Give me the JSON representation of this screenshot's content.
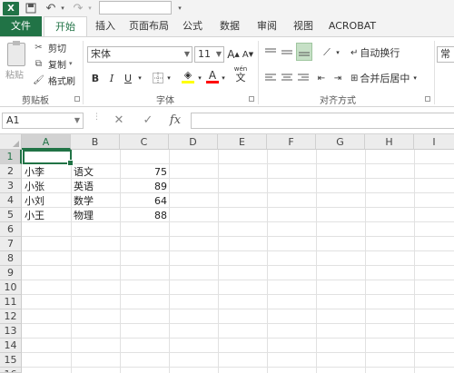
{
  "quick_access": {
    "logo": "X",
    "save_icon": "save-icon",
    "undo_icon": "undo-icon",
    "redo_icon": "redo-icon",
    "customize_icon": "customize-qat-icon",
    "search_value": ""
  },
  "tabs": [
    {
      "label": "文件"
    },
    {
      "label": "开始"
    },
    {
      "label": "插入"
    },
    {
      "label": "页面布局"
    },
    {
      "label": "公式"
    },
    {
      "label": "数据"
    },
    {
      "label": "审阅"
    },
    {
      "label": "视图"
    },
    {
      "label": "ACROBAT"
    }
  ],
  "ribbon": {
    "clipboard": {
      "paste": "粘贴",
      "cut": "剪切",
      "copy": "复制",
      "format_painter": "格式刷",
      "group_label": "剪贴板"
    },
    "font": {
      "font_name": "宋体",
      "font_size": "11",
      "bold": "B",
      "italic": "I",
      "underline": "U",
      "grow": "A",
      "shrink": "A",
      "font_color_letter": "A",
      "wen": "wén",
      "wen_char": "文",
      "group_label": "字体"
    },
    "alignment": {
      "wrap_text": "自动换行",
      "merge_center": "合并后居中",
      "group_label": "对齐方式"
    },
    "number": {
      "format": "常规"
    }
  },
  "formula_bar": {
    "name_box": "A1",
    "cancel": "✕",
    "enter": "✓",
    "fx": "fx",
    "value": ""
  },
  "sheet": {
    "columns": [
      "A",
      "B",
      "C",
      "D",
      "E",
      "F",
      "G",
      "H",
      "I"
    ],
    "rows": [
      "1",
      "2",
      "3",
      "4",
      "5",
      "6",
      "7",
      "8",
      "9",
      "10",
      "11",
      "12",
      "13",
      "14",
      "15",
      "16"
    ],
    "active_cell": "A1",
    "data": [
      {
        "name": "小李",
        "subject": "语文",
        "score": "75"
      },
      {
        "name": "小张",
        "subject": "英语",
        "score": "89"
      },
      {
        "name": "小刘",
        "subject": "数学",
        "score": "64"
      },
      {
        "name": "小王",
        "subject": "物理",
        "score": "88"
      }
    ]
  },
  "colors": {
    "accent": "#217346",
    "highlight_yellow": "#ffff00",
    "font_red": "#ff0000"
  }
}
